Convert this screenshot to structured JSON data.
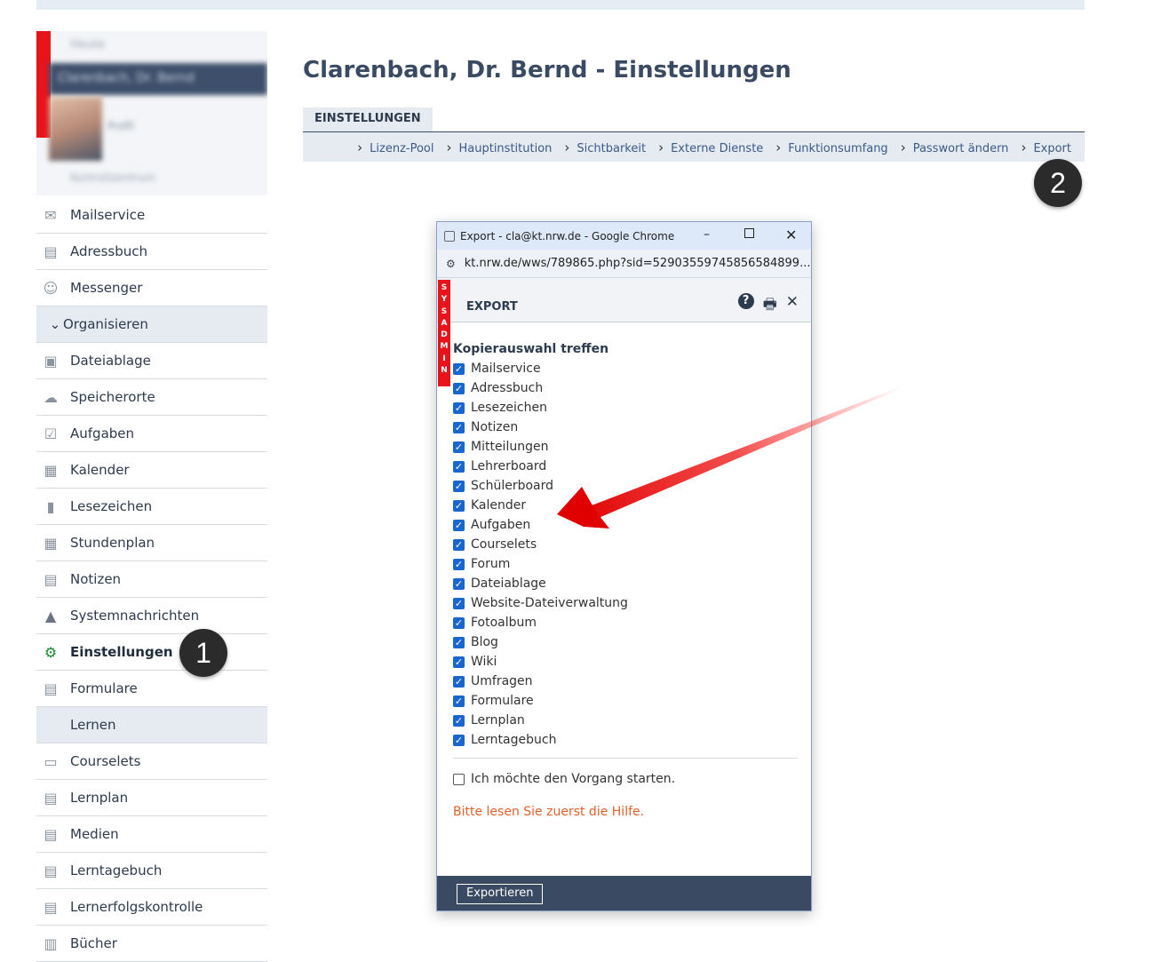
{
  "page": {
    "title": "Clarenbach, Dr. Bernd - Einstellungen",
    "tab": "EINSTELLUNGEN",
    "subnav": [
      "Lizenz-Pool",
      "Hauptinstitution",
      "Sichtbarkeit",
      "Externe Dienste",
      "Funktionsumfang",
      "Passwort ändern",
      "Export"
    ]
  },
  "profile": {
    "small_label": "Heute",
    "name": "Clarenbach, Dr. Bernd",
    "status": "Profil",
    "link": "Kontrollzentrum"
  },
  "sidebar": {
    "items": [
      {
        "label": "Mailservice",
        "icon": "envelope-icon"
      },
      {
        "label": "Adressbuch",
        "icon": "address-book-icon"
      },
      {
        "label": "Messenger",
        "icon": "messenger-icon"
      },
      {
        "label": "Organisieren",
        "icon": "chevron-down-icon",
        "group": true
      },
      {
        "label": "Dateiablage",
        "icon": "briefcase-icon"
      },
      {
        "label": "Speicherorte",
        "icon": "cloud-upload-icon"
      },
      {
        "label": "Aufgaben",
        "icon": "checkbox-icon"
      },
      {
        "label": "Kalender",
        "icon": "calendar-icon"
      },
      {
        "label": "Lesezeichen",
        "icon": "bookmark-icon"
      },
      {
        "label": "Stundenplan",
        "icon": "table-icon"
      },
      {
        "label": "Notizen",
        "icon": "note-icon"
      },
      {
        "label": "Systemnachrichten",
        "icon": "warning-icon"
      },
      {
        "label": "Einstellungen",
        "icon": "gear-icon",
        "active": true
      },
      {
        "label": "Formulare",
        "icon": "form-icon"
      },
      {
        "label": "Lernen",
        "icon": "",
        "group": true
      },
      {
        "label": "Courselets",
        "icon": "courselet-icon"
      },
      {
        "label": "Lernplan",
        "icon": "clipboard-icon"
      },
      {
        "label": "Medien",
        "icon": "media-icon"
      },
      {
        "label": "Lerntagebuch",
        "icon": "diary-icon"
      },
      {
        "label": "Lernerfolgskontrolle",
        "icon": "checklist-icon"
      },
      {
        "label": "Bücher",
        "icon": "books-icon"
      }
    ]
  },
  "badges": {
    "one": "1",
    "two": "2"
  },
  "popup": {
    "window_title": "Export - cla@kt.nrw.de - Google Chrome",
    "url": "kt.nrw.de/wws/789865.php?sid=52903559745856584899...",
    "heading": "EXPORT",
    "sysadmin": [
      "S",
      "Y",
      "S",
      "A",
      "D",
      "M",
      "I",
      "N"
    ],
    "section": "Kopierauswahl treffen",
    "options": [
      "Mailservice",
      "Adressbuch",
      "Lesezeichen",
      "Notizen",
      "Mitteilungen",
      "Lehrerboard",
      "Schülerboard",
      "Kalender",
      "Aufgaben",
      "Courselets",
      "Forum",
      "Dateiablage",
      "Website-Dateiverwaltung",
      "Fotoalbum",
      "Blog",
      "Wiki",
      "Umfragen",
      "Formulare",
      "Lernplan",
      "Lerntagebuch"
    ],
    "confirm_label": "Ich möchte den Vorgang starten.",
    "hint": "Bitte lesen Sie zuerst die Hilfe.",
    "button": "Exportieren"
  }
}
